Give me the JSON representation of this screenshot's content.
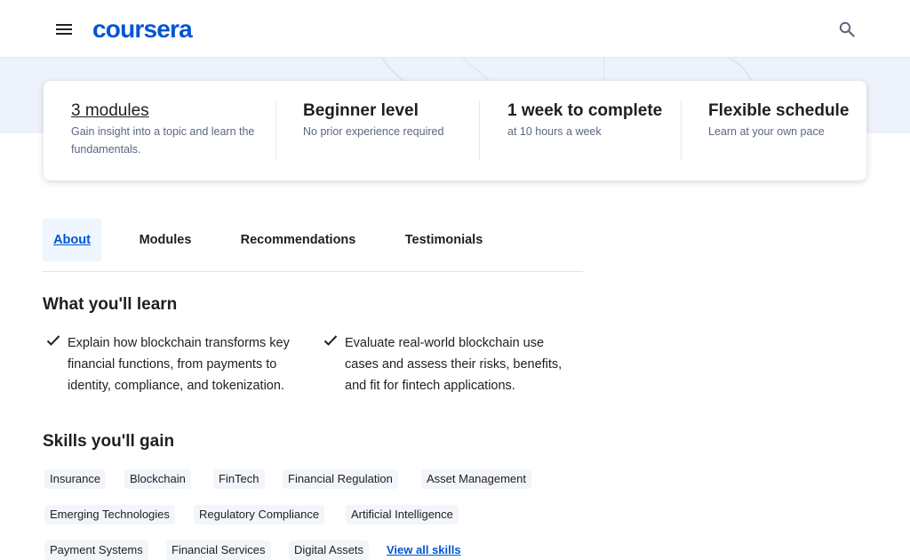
{
  "header": {
    "logo_text": "coursera",
    "menu_icon": "menu-icon",
    "search_icon": "search-icon",
    "brand_color": "#0056d2"
  },
  "info": {
    "modules_title": "3 modules",
    "modules_sub": "Gain insight into a topic and learn the fundamentals.",
    "level_title": "Beginner level",
    "level_sub": "No prior experience required",
    "time_title": "1 week to complete",
    "time_sub": "at 10 hours a week",
    "schedule_title": "Flexible schedule",
    "schedule_sub": "Learn at your own pace"
  },
  "tabs": [
    {
      "label": "About"
    },
    {
      "label": "Modules"
    },
    {
      "label": "Recommendations"
    },
    {
      "label": "Testimonials"
    }
  ],
  "learn": {
    "heading": "What you'll learn",
    "items": [
      {
        "text": "Explain how blockchain transforms key financial functions, from payments to identity, compliance, and tokenization."
      },
      {
        "text": "Evaluate real-world blockchain use cases and assess their risks, benefits, and fit for fintech applications."
      }
    ]
  },
  "skills": {
    "heading": "Skills you'll gain",
    "chips": [
      "Insurance",
      "Blockchain",
      "FinTech",
      "Financial Regulation",
      "Asset Management",
      "Emerging Technologies",
      "Regulatory Compliance",
      "Artificial Intelligence",
      "Payment Systems",
      "Financial Services",
      "Digital Assets"
    ],
    "view_all": "View all skills"
  }
}
